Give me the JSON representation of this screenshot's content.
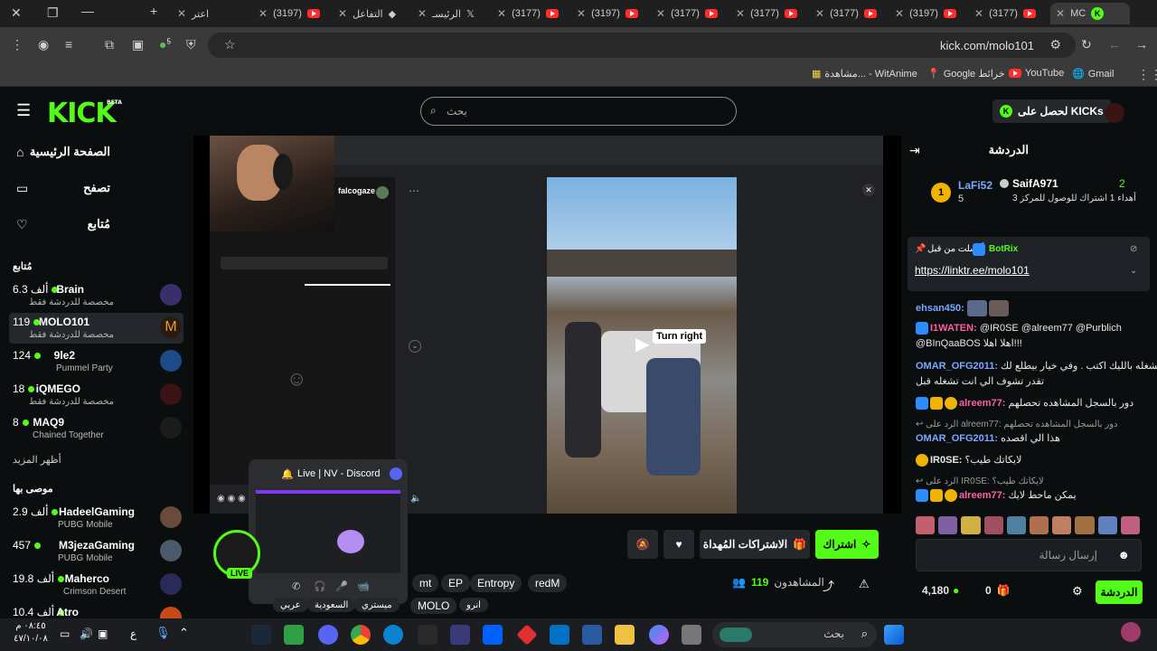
{
  "browser": {
    "tabs": [
      {
        "label": "اعتر",
        "icon": "close-icon"
      },
      {
        "label": "(3197)",
        "icon": "youtube-icon"
      },
      {
        "label": "التفاعل",
        "icon": "generic-icon"
      },
      {
        "label": "الرئيسـ",
        "icon": "x-icon"
      },
      {
        "label": "(3177)",
        "icon": "youtube-icon"
      },
      {
        "label": "(3197)",
        "icon": "youtube-icon"
      },
      {
        "label": "(3177)",
        "icon": "youtube-icon"
      },
      {
        "label": "(3177)",
        "icon": "youtube-icon"
      },
      {
        "label": "(3177)",
        "icon": "youtube-icon"
      },
      {
        "label": "(3197)",
        "icon": "youtube-icon"
      },
      {
        "label": "(3177)",
        "icon": "youtube-icon"
      },
      {
        "label": "MC",
        "icon": "kick-icon"
      }
    ],
    "url": "kick.com/molo101",
    "extension_badge": "5",
    "bookmarks": [
      "Gmail",
      "YouTube",
      "Google خرائط",
      "مشاهدة... - WitAnime"
    ]
  },
  "kick": {
    "logo": "KICK",
    "logo_badge": "BETA",
    "search_placeholder": "بحث",
    "get_kicks": "لحصل على KICKs",
    "nav": {
      "home": "الصفحة الرئيسية",
      "browse": "تصفح",
      "following": "مُتابع"
    },
    "following_title": "مُتابع",
    "show_more": "أظهر المزيد",
    "recommended_title": "موصى بها",
    "following_channels": [
      {
        "name": "Brain",
        "viewers": "6.3 ألف",
        "sub": "مخصصة للدردشة فقط"
      },
      {
        "name": "MOLO101",
        "viewers": "119",
        "sub": "مخصصة للدردشة فقط"
      },
      {
        "name": "9le2",
        "viewers": "124",
        "sub": "Pummel Party"
      },
      {
        "name": "iQMEGO",
        "viewers": "18",
        "sub": "مخصصة للدردشة فقط"
      },
      {
        "name": "MAQ9",
        "viewers": "8",
        "sub": "Chained Together"
      }
    ],
    "recommended_channels": [
      {
        "name": "HadeelGaming",
        "viewers": "2.9 ألف",
        "sub": "PUBG Mobile"
      },
      {
        "name": "M3jezaGaming",
        "viewers": "457",
        "sub": "PUBG Mobile"
      },
      {
        "name": "Maherco",
        "viewers": "19.8 ألف",
        "sub": "Crimson Desert"
      },
      {
        "name": "Atro",
        "viewers": "10.4 ألف",
        "sub": ""
      }
    ],
    "player": {
      "tiktok_user": "falcogaze",
      "video_caption": "Turn right",
      "discord_title": "Live | NV - Discord",
      "live_badge": "LIVE"
    },
    "actions": {
      "subscribe": "اشتراك",
      "gift_subs": "الاشتراكات المُهداة"
    },
    "stats": {
      "viewers_label": "المشاهدون",
      "viewers": "119"
    },
    "tags": [
      "mt",
      "EP",
      "Entropy",
      "redM",
      "MOLO",
      "انرو",
      "ميستري",
      "السعودية",
      "عربي"
    ],
    "chat": {
      "title": "الدردشة",
      "leader1": {
        "name": "SaifA971",
        "count": "2",
        "text": "أهداء 1 اشتراك للوصول للمركز 3"
      },
      "leader2": {
        "name": "LaFi52",
        "count": "5"
      },
      "pinned_by": "أرسلت من قبل",
      "pinned_user": "BotRix",
      "pinned_link": "https://linktr.ee/molo101",
      "messages": [
        {
          "user": "ehsan450:",
          "text": ""
        },
        {
          "user": "I1WATEN:",
          "text": "@IR0SE @alreem77 @Purblich"
        },
        {
          "user": "",
          "text": "@BInQaaBOS اهلا اهلا!!!"
        },
        {
          "user": "OMAR_OFG2011:",
          "text": "اذا تشغله بالليك اكتب . وفي خيار بيطلع لك"
        },
        {
          "user": "",
          "text": "تقدر تشوف الي انت تشغله قبل"
        },
        {
          "user": "alreem77:",
          "text": "دور بالسجل المشاهده تحصلهم"
        },
        {
          "user": "",
          "text": "الرد على alreem77: دور بالسجل المشاهده تحصلهم"
        },
        {
          "user": "OMAR_OFG2011:",
          "text": "هذا الي اقصده"
        },
        {
          "user": "IR0SE:",
          "text": "لايكاتك طيب؟"
        },
        {
          "user": "",
          "text": "الرد على IR0SE: لايكاتك طيب؟"
        },
        {
          "user": "alreem77:",
          "text": "يمكن ماحط لايك"
        }
      ],
      "input_placeholder": "إرسال رسالة",
      "send_label": "الدردشة",
      "kicks_balance": "4,180",
      "points": "0"
    }
  },
  "taskbar": {
    "search_placeholder": "بحث",
    "time": "٠٨:٤٥ م",
    "date": "٤٧/١٠/٠٨",
    "lang": "ع"
  }
}
